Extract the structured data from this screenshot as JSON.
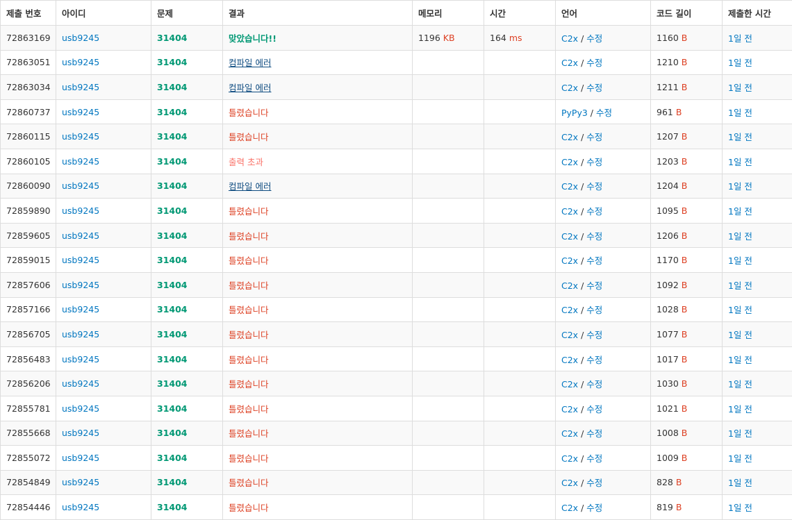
{
  "colors": {
    "link": "#0076c0",
    "accepted": "#009874",
    "wrong": "#dd4124",
    "compile_error": "#0f4c81",
    "output_limit": "#fa7268"
  },
  "headers": [
    "제출 번호",
    "아이디",
    "문제",
    "결과",
    "메모리",
    "시간",
    "언어",
    "코드 길이",
    "제출한 시간"
  ],
  "edit_label": "수정",
  "byte_unit": "B",
  "rows": [
    {
      "id": "72863169",
      "user": "usb9245",
      "problem": "31404",
      "result": "맞았습니다!!",
      "rtype": "ac",
      "memory": "1196",
      "memory_unit": "KB",
      "time": "164",
      "time_unit": "ms",
      "lang": "C2x",
      "length": "1160",
      "when": "1일 전"
    },
    {
      "id": "72863051",
      "user": "usb9245",
      "problem": "31404",
      "result": "컴파일 에러",
      "rtype": "ce",
      "memory": "",
      "memory_unit": "",
      "time": "",
      "time_unit": "",
      "lang": "C2x",
      "length": "1210",
      "when": "1일 전"
    },
    {
      "id": "72863034",
      "user": "usb9245",
      "problem": "31404",
      "result": "컴파일 에러",
      "rtype": "ce",
      "memory": "",
      "memory_unit": "",
      "time": "",
      "time_unit": "",
      "lang": "C2x",
      "length": "1211",
      "when": "1일 전"
    },
    {
      "id": "72860737",
      "user": "usb9245",
      "problem": "31404",
      "result": "틀렸습니다",
      "rtype": "wa",
      "memory": "",
      "memory_unit": "",
      "time": "",
      "time_unit": "",
      "lang": "PyPy3",
      "length": "961",
      "when": "1일 전"
    },
    {
      "id": "72860115",
      "user": "usb9245",
      "problem": "31404",
      "result": "틀렸습니다",
      "rtype": "wa",
      "memory": "",
      "memory_unit": "",
      "time": "",
      "time_unit": "",
      "lang": "C2x",
      "length": "1207",
      "when": "1일 전"
    },
    {
      "id": "72860105",
      "user": "usb9245",
      "problem": "31404",
      "result": "출력 초과",
      "rtype": "ole",
      "memory": "",
      "memory_unit": "",
      "time": "",
      "time_unit": "",
      "lang": "C2x",
      "length": "1203",
      "when": "1일 전"
    },
    {
      "id": "72860090",
      "user": "usb9245",
      "problem": "31404",
      "result": "컴파일 에러",
      "rtype": "ce",
      "memory": "",
      "memory_unit": "",
      "time": "",
      "time_unit": "",
      "lang": "C2x",
      "length": "1204",
      "when": "1일 전"
    },
    {
      "id": "72859890",
      "user": "usb9245",
      "problem": "31404",
      "result": "틀렸습니다",
      "rtype": "wa",
      "memory": "",
      "memory_unit": "",
      "time": "",
      "time_unit": "",
      "lang": "C2x",
      "length": "1095",
      "when": "1일 전"
    },
    {
      "id": "72859605",
      "user": "usb9245",
      "problem": "31404",
      "result": "틀렸습니다",
      "rtype": "wa",
      "memory": "",
      "memory_unit": "",
      "time": "",
      "time_unit": "",
      "lang": "C2x",
      "length": "1206",
      "when": "1일 전"
    },
    {
      "id": "72859015",
      "user": "usb9245",
      "problem": "31404",
      "result": "틀렸습니다",
      "rtype": "wa",
      "memory": "",
      "memory_unit": "",
      "time": "",
      "time_unit": "",
      "lang": "C2x",
      "length": "1170",
      "when": "1일 전"
    },
    {
      "id": "72857606",
      "user": "usb9245",
      "problem": "31404",
      "result": "틀렸습니다",
      "rtype": "wa",
      "memory": "",
      "memory_unit": "",
      "time": "",
      "time_unit": "",
      "lang": "C2x",
      "length": "1092",
      "when": "1일 전"
    },
    {
      "id": "72857166",
      "user": "usb9245",
      "problem": "31404",
      "result": "틀렸습니다",
      "rtype": "wa",
      "memory": "",
      "memory_unit": "",
      "time": "",
      "time_unit": "",
      "lang": "C2x",
      "length": "1028",
      "when": "1일 전"
    },
    {
      "id": "72856705",
      "user": "usb9245",
      "problem": "31404",
      "result": "틀렸습니다",
      "rtype": "wa",
      "memory": "",
      "memory_unit": "",
      "time": "",
      "time_unit": "",
      "lang": "C2x",
      "length": "1077",
      "when": "1일 전"
    },
    {
      "id": "72856483",
      "user": "usb9245",
      "problem": "31404",
      "result": "틀렸습니다",
      "rtype": "wa",
      "memory": "",
      "memory_unit": "",
      "time": "",
      "time_unit": "",
      "lang": "C2x",
      "length": "1017",
      "when": "1일 전"
    },
    {
      "id": "72856206",
      "user": "usb9245",
      "problem": "31404",
      "result": "틀렸습니다",
      "rtype": "wa",
      "memory": "",
      "memory_unit": "",
      "time": "",
      "time_unit": "",
      "lang": "C2x",
      "length": "1030",
      "when": "1일 전"
    },
    {
      "id": "72855781",
      "user": "usb9245",
      "problem": "31404",
      "result": "틀렸습니다",
      "rtype": "wa",
      "memory": "",
      "memory_unit": "",
      "time": "",
      "time_unit": "",
      "lang": "C2x",
      "length": "1021",
      "when": "1일 전"
    },
    {
      "id": "72855668",
      "user": "usb9245",
      "problem": "31404",
      "result": "틀렸습니다",
      "rtype": "wa",
      "memory": "",
      "memory_unit": "",
      "time": "",
      "time_unit": "",
      "lang": "C2x",
      "length": "1008",
      "when": "1일 전"
    },
    {
      "id": "72855072",
      "user": "usb9245",
      "problem": "31404",
      "result": "틀렸습니다",
      "rtype": "wa",
      "memory": "",
      "memory_unit": "",
      "time": "",
      "time_unit": "",
      "lang": "C2x",
      "length": "1009",
      "when": "1일 전"
    },
    {
      "id": "72854849",
      "user": "usb9245",
      "problem": "31404",
      "result": "틀렸습니다",
      "rtype": "wa",
      "memory": "",
      "memory_unit": "",
      "time": "",
      "time_unit": "",
      "lang": "C2x",
      "length": "828",
      "when": "1일 전"
    },
    {
      "id": "72854446",
      "user": "usb9245",
      "problem": "31404",
      "result": "틀렸습니다",
      "rtype": "wa",
      "memory": "",
      "memory_unit": "",
      "time": "",
      "time_unit": "",
      "lang": "C2x",
      "length": "819",
      "when": "1일 전"
    }
  ]
}
